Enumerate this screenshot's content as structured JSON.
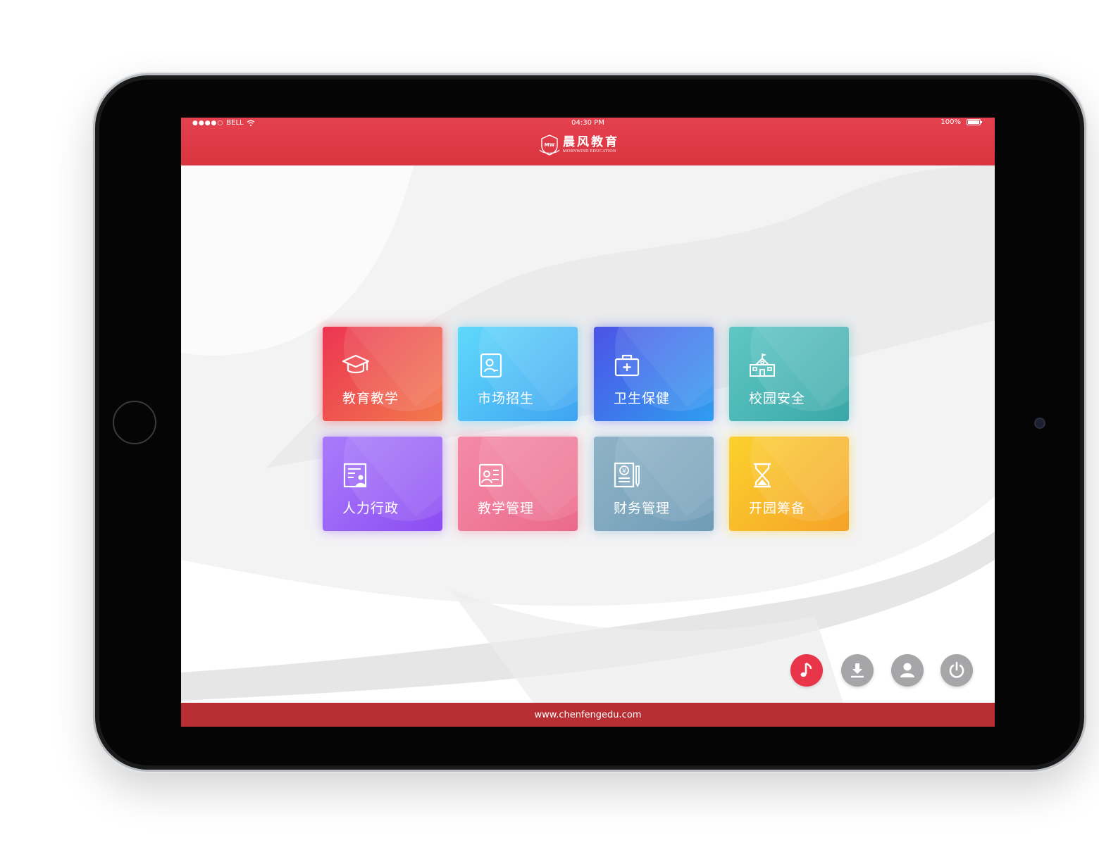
{
  "status_bar": {
    "signal": "●●●●○",
    "carrier": "BELL",
    "time": "04:30  PM",
    "battery": "100%"
  },
  "header": {
    "brand_zh": "晨风教育",
    "brand_en": "MORNWIND EDUCATION",
    "brand_mark_text": "MW"
  },
  "tiles": [
    {
      "label": "教育教学",
      "icon": "graduation-cap-icon"
    },
    {
      "label": "市场招生",
      "icon": "contact-card-icon"
    },
    {
      "label": "卫生保健",
      "icon": "medical-kit-icon"
    },
    {
      "label": "校园安全",
      "icon": "school-building-icon"
    },
    {
      "label": "人力行政",
      "icon": "personnel-document-icon"
    },
    {
      "label": "教学管理",
      "icon": "teaching-board-icon"
    },
    {
      "label": "财务管理",
      "icon": "finance-ledger-icon"
    },
    {
      "label": "开园筹备",
      "icon": "hourglass-icon"
    }
  ],
  "actions": [
    {
      "name": "music",
      "icon": "music-note-icon",
      "color": "#e8354a"
    },
    {
      "name": "download",
      "icon": "download-icon",
      "color": "#a6a6a8"
    },
    {
      "name": "user",
      "icon": "user-icon",
      "color": "#a6a6a8"
    },
    {
      "name": "power",
      "icon": "power-icon",
      "color": "#a6a6a8"
    }
  ],
  "footer": {
    "url": "www.chenfengedu.com"
  },
  "colors": {
    "header": "#e23c4a",
    "footer": "#b92e33"
  }
}
